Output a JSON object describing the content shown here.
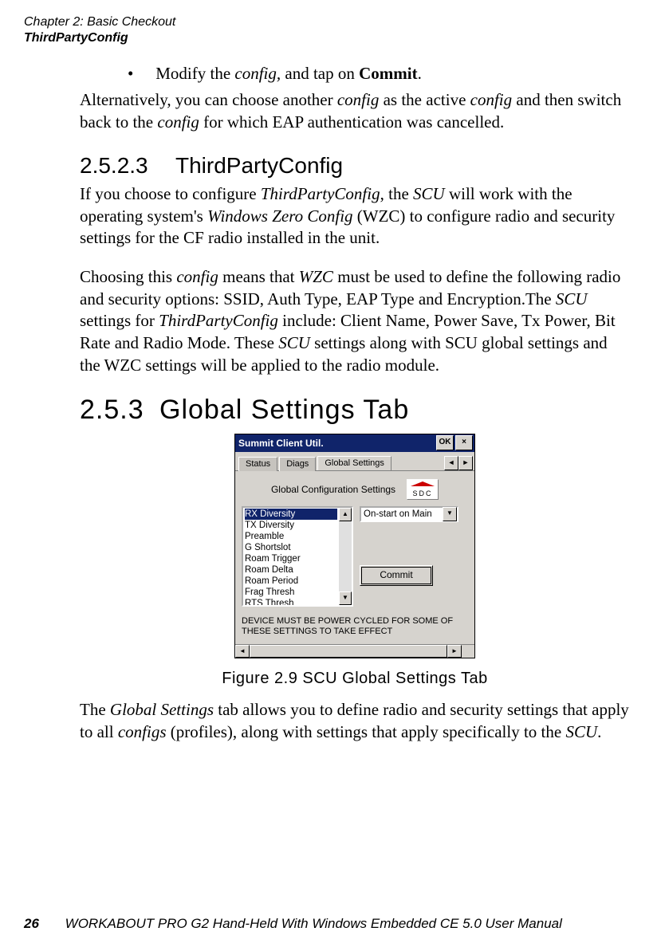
{
  "header": {
    "chapter": "Chapter 2: Basic Checkout",
    "section": "ThirdPartyConfig"
  },
  "bullet": {
    "marker": "•",
    "text_before": "Modify the ",
    "italic1": "config,",
    "text_mid": " and tap on ",
    "bold": "Commit",
    "text_after": "."
  },
  "para1": "Alternatively, you can choose another config as the active config and then switch back to the config for which EAP authentication was cancelled.",
  "h3": {
    "num": "2.5.2.3",
    "title": "ThirdPartyConfig"
  },
  "para2": "If you choose to configure ThirdPartyConfig, the SCU will work with the operating system's Windows Zero Config (WZC) to configure radio and security settings for the CF radio installed in the unit.",
  "para3": "Choosing this config means that WZC must be used to define the following radio and security options: SSID, Auth Type, EAP Type and Encryption.The SCU settings for ThirdPartyConfig include: Client Name, Power Save, Tx Power, Bit Rate and Radio Mode. These SCU settings along with SCU global settings and the WZC settings will be applied to the radio module.",
  "h2": {
    "num": "2.5.3",
    "title": "Global Settings Tab"
  },
  "screenshot": {
    "title": "Summit Client Util.",
    "ok": "OK",
    "close": "×",
    "tabs": {
      "status": "Status",
      "diags": "Diags",
      "global": "Global Settings"
    },
    "left_arrow": "◄",
    "right_arrow": "►",
    "panel_title": "Global Configuration Settings",
    "logo_text": "SDC",
    "list": {
      "items": [
        "RX Diversity",
        "TX Diversity",
        "Preamble",
        "G Shortslot",
        "Roam Trigger",
        "Roam Delta",
        "Roam Period",
        "Frag Thresh",
        "RTS Thresh"
      ],
      "up": "▲",
      "down": "▼"
    },
    "combo": {
      "value": "On-start on Main",
      "arrow": "▼"
    },
    "commit": "Commit",
    "note": "DEVICE MUST BE POWER CYCLED FOR SOME OF THESE SETTINGS TO TAKE EFFECT",
    "hscroll": {
      "left": "◄",
      "right": "►"
    }
  },
  "figcaption": "Figure 2.9 SCU Global Settings Tab",
  "para4": "The Global Settings tab allows you to define radio and security settings that apply to all configs (profiles), along with settings that apply specifically to the SCU.",
  "footer": {
    "page": "26",
    "book": "WORKABOUT PRO G2 Hand-Held With Windows Embedded CE 5.0 User Manual"
  }
}
